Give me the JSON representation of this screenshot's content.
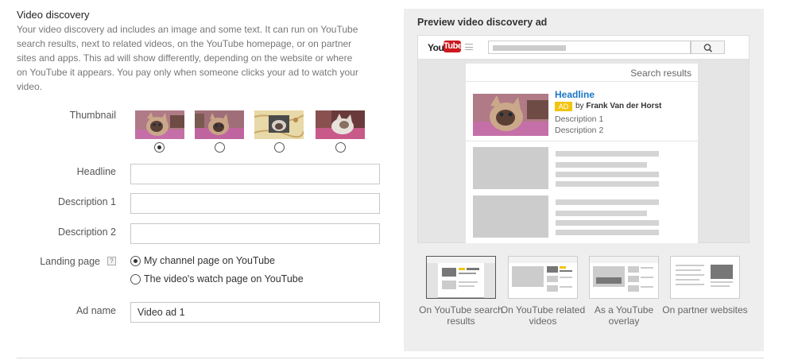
{
  "section": {
    "title": "Video discovery",
    "intro": "Your video discovery ad includes an image and some text. It can run on YouTube search results, next to related videos, on the YouTube homepage, or on partner sites and apps. This ad will show differently, depending on the website or where on YouTube it appears. You pay only when someone clicks your ad to watch your video."
  },
  "form": {
    "thumbnail_label": "Thumbnail",
    "thumbnail_selected_index": 0,
    "headline_label": "Headline",
    "headline_value": "",
    "description1_label": "Description 1",
    "description1_value": "",
    "description2_label": "Description 2",
    "description2_value": "",
    "landing_page_label": "Landing page",
    "landing_help": "?",
    "landing_options": [
      "My channel page on YouTube",
      "The video's watch page on YouTube"
    ],
    "landing_selected_index": 0,
    "ad_name_label": "Ad name",
    "ad_name_value": "Video ad 1"
  },
  "preview": {
    "title": "Preview video discovery ad",
    "logo_you": "You",
    "logo_tube": "Tube",
    "results_label": "Search results",
    "ad": {
      "headline": "Headline",
      "badge": "AD",
      "by": "by",
      "author": "Frank Van der Horst",
      "description1": "Description 1",
      "description2": "Description 2"
    },
    "placements": [
      {
        "label": "On YouTube search results",
        "selected": true
      },
      {
        "label": "On YouTube related videos",
        "selected": false
      },
      {
        "label": "As a YouTube overlay",
        "selected": false
      },
      {
        "label": "On partner websites",
        "selected": false
      }
    ]
  },
  "colors": {
    "headline_link": "#1a76c6",
    "ad_badge": "#f1c40f",
    "youtube_red": "#cc181e",
    "panel_bg": "#eeeeee"
  }
}
